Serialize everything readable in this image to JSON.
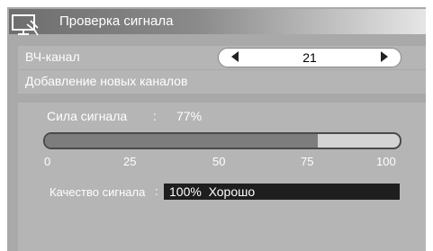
{
  "title": "Проверка сигнала",
  "title_icon": "antenna-monitor-icon",
  "rf_channel": {
    "label": "ВЧ-канал",
    "value": "21"
  },
  "add_channels": {
    "label": "Добавление новых каналов"
  },
  "signal_strength": {
    "label": "Сила сигнала",
    "separator": ":",
    "value_text": "77%",
    "level_percent": 77,
    "scale_ticks": [
      "0",
      "25",
      "50",
      "75",
      "100"
    ]
  },
  "signal_quality": {
    "label": "Качество сигнала",
    "separator": ":",
    "value_text": "100%  Хорошо"
  },
  "colors": {
    "panel": "#a9a9a9",
    "row": "#b5b5b5",
    "bar_fill": "#7d7d7d",
    "quality_box": "#1e1e1e"
  }
}
